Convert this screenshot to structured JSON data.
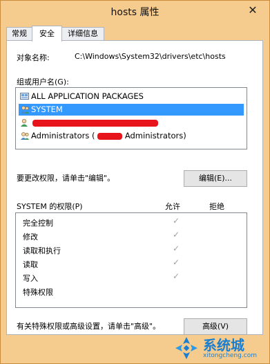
{
  "window": {
    "title": "hosts 属性",
    "close_glyph": "✕"
  },
  "tabs": [
    {
      "label": "常规"
    },
    {
      "label": "安全"
    },
    {
      "label": "详细信息"
    }
  ],
  "object": {
    "label": "对象名称:",
    "value": "C:\\Windows\\System32\\drivers\\etc\\hosts"
  },
  "groups": {
    "label": "组或用户名(G):",
    "items": [
      {
        "label": "ALL APPLICATION PACKAGES",
        "icon": "app-packages-icon"
      },
      {
        "label": "SYSTEM",
        "icon": "user-group-icon"
      },
      {
        "label": "",
        "icon": "user-icon"
      },
      {
        "label": "Administrators (",
        "suffix": "Administrators)",
        "icon": "user-group-icon"
      }
    ]
  },
  "change_hint": "要更改权限，请单击\"编辑\"。",
  "edit_button": "编辑(E)...",
  "permissions": {
    "header": "SYSTEM 的权限(P)",
    "allow": "允许",
    "deny": "拒绝",
    "rows": [
      {
        "name": "完全控制",
        "allow": "✓"
      },
      {
        "name": "修改",
        "allow": "✓"
      },
      {
        "name": "读取和执行",
        "allow": "✓"
      },
      {
        "name": "读取",
        "allow": "✓"
      },
      {
        "name": "写入",
        "allow": "✓"
      },
      {
        "name": "特殊权限",
        "allow": ""
      }
    ]
  },
  "advanced_hint": "有关特殊权限或高级设置，请单击\"高级\"。",
  "advanced_button": "高级(V)",
  "watermark": {
    "brand": "系统城",
    "url": "xitongcheng.com"
  },
  "colors": {
    "selection": "#3399ff",
    "redaction": "#e8141b",
    "frame": "#f6cb8e"
  }
}
